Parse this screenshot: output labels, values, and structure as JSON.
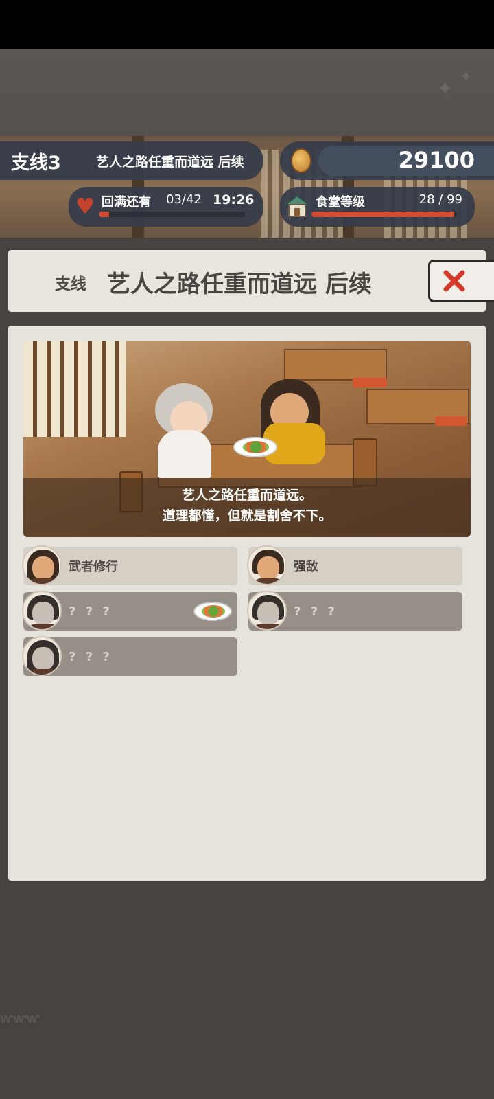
{
  "hud": {
    "quest_tag": "支线3",
    "quest_title": "艺人之路任重而道远 后续",
    "coins": "29100",
    "energy_label": "回满还有",
    "energy_count": "03/42",
    "energy_timer": "19:26",
    "energy_fill": 0.07,
    "level_label": "食堂等级",
    "level_value": "28 / 99",
    "level_fill": 0.98
  },
  "title": {
    "prefix": "支线",
    "main": "艺人之路任重而道远 后续"
  },
  "scene": {
    "caption_line1": "艺人之路任重而道远。",
    "caption_line2": "道理都懂，但就是割舍不下。"
  },
  "stories": [
    {
      "label": "武者修行",
      "state": "unlocked"
    },
    {
      "label": "强敌",
      "state": "unlocked"
    },
    {
      "label": "? ? ?",
      "state": "locked"
    },
    {
      "label": "? ? ?",
      "state": "locked"
    },
    {
      "label": "? ? ?",
      "state": "locked"
    }
  ],
  "colors": {
    "accent_red": "#cf4f35",
    "close_red": "#d43b2a",
    "hud_bg": "#343c4a"
  },
  "icons": {
    "coin": "coin-icon",
    "heart": "heart-icon",
    "house": "house-icon",
    "close": "close-icon",
    "dish": "dish-icon"
  }
}
